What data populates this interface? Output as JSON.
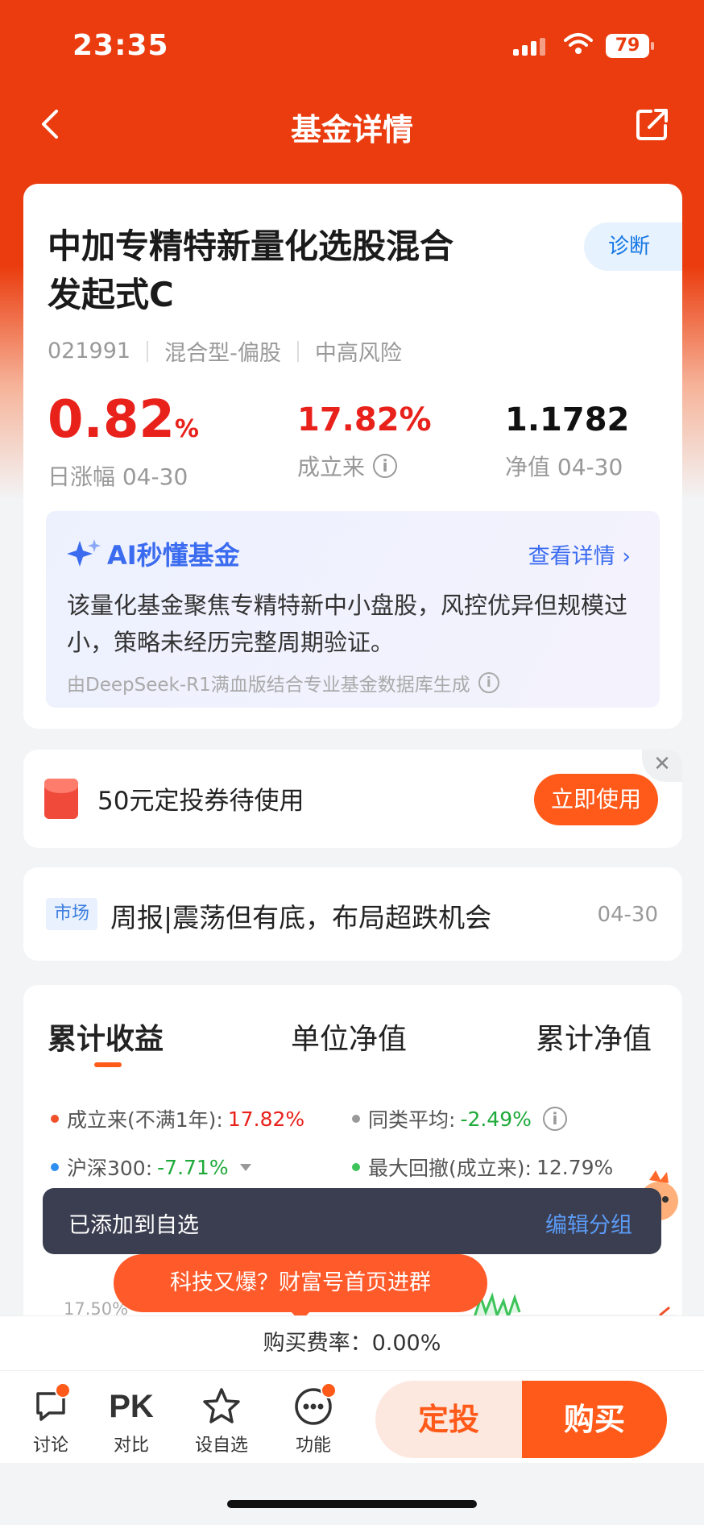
{
  "status_bar": {
    "time": "23:35",
    "battery": "79"
  },
  "nav": {
    "title": "基金详情"
  },
  "fund": {
    "name": "中加专精特新量化选股混合发起式C",
    "diagnose_label": "诊断",
    "code": "021991",
    "type": "混合型-偏股",
    "risk": "中高风险",
    "daily_change": "0.82",
    "daily_change_unit": "%",
    "daily_change_label": "日涨幅 04-30",
    "since_inception": "17.82%",
    "since_inception_label": "成立来",
    "nav_value": "1.1782",
    "nav_label": "净值 04-30"
  },
  "ai": {
    "title": "AI秒懂基金",
    "more": "查看详情",
    "summary": "该量化基金聚焦专精特新中小盘股，风控优异但规模过小，策略未经历完整周期验证。",
    "source": "由DeepSeek-R1满血版结合专业基金数据库生成"
  },
  "coupon": {
    "text": "50元定投券待使用",
    "button": "立即使用"
  },
  "news": {
    "tag": "市场",
    "title": "周报|震荡但有底，布局超跌机会",
    "date": "04-30"
  },
  "perf": {
    "tabs": [
      "累计收益",
      "单位净值",
      "累计净值"
    ],
    "legend": {
      "inception_label": "成立来(不满1年):",
      "inception_value": "17.82%",
      "peer_label": "同类平均:",
      "peer_value": "-2.49%",
      "hs300_label": "沪深300:",
      "hs300_value": "-7.71%",
      "drawdown_label": "最大回撤(成立来):",
      "drawdown_value": "12.79%"
    },
    "y_tick": "17.50%",
    "colors": {
      "fund": "#f0502a",
      "peer": "#999999",
      "hs300": "#2f8ff0",
      "drawdown": "#3cc45a"
    }
  },
  "toast": {
    "text": "已添加到自选",
    "action": "编辑分组"
  },
  "promo": {
    "text": "科技又爆？财富号首页进群"
  },
  "fee": {
    "text": "购买费率：0.00%"
  },
  "tabbar": {
    "discuss": "讨论",
    "compare_icon": "PK",
    "compare": "对比",
    "watchlist": "设自选",
    "functions": "功能",
    "invest_plan": "定投",
    "buy": "购买"
  }
}
